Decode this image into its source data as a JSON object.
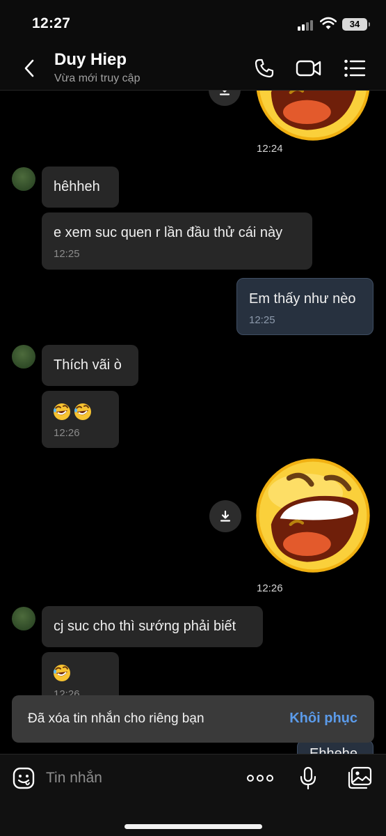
{
  "status_bar": {
    "time": "12:27",
    "battery": "34"
  },
  "header": {
    "contact_name": "Duy Hiep",
    "contact_status": "Vừa mới truy cập",
    "icons": [
      "back-arrow-icon",
      "phone-icon",
      "video-camera-icon",
      "list-menu-icon"
    ]
  },
  "messages": [
    {
      "id": "m0",
      "type": "sticker",
      "direction": "outgoing",
      "sticker": "laughing-face",
      "time": "12:24"
    },
    {
      "id": "m1",
      "type": "text",
      "direction": "incoming",
      "text": "hêhheh"
    },
    {
      "id": "m2",
      "type": "text",
      "direction": "incoming",
      "text": "e xem suc quen r lần đầu thử cái này",
      "time": "12:25"
    },
    {
      "id": "m3",
      "type": "text",
      "direction": "outgoing",
      "text": "Em thấy như nèo",
      "time": "12:25"
    },
    {
      "id": "m4",
      "type": "text",
      "direction": "incoming",
      "text": "Thích vãi ò"
    },
    {
      "id": "m5",
      "type": "emoji",
      "direction": "incoming",
      "emoji": [
        "rolling-on-floor-laughing",
        "rolling-on-floor-laughing"
      ],
      "time": "12:26"
    },
    {
      "id": "m6",
      "type": "sticker",
      "direction": "outgoing",
      "sticker": "laughing-face",
      "time": "12:26"
    },
    {
      "id": "m7",
      "type": "text",
      "direction": "incoming",
      "text": "cj suc cho thì sướng phải biết"
    },
    {
      "id": "m8",
      "type": "emoji",
      "direction": "incoming",
      "emoji": [
        "rolling-on-floor-laughing"
      ],
      "time": "12:26"
    },
    {
      "id": "m9",
      "type": "text",
      "direction": "outgoing",
      "text": "Ehhehe"
    }
  ],
  "toast": {
    "text": "Đã xóa tin nhắn cho riêng bạn",
    "action": "Khôi phục"
  },
  "input_bar": {
    "placeholder": "Tin nhắn",
    "icons": [
      "emoji-sticker-icon",
      "more-dots-icon",
      "microphone-icon",
      "image-icon"
    ]
  },
  "colors": {
    "background": "#000000",
    "incoming_bubble": "#272727",
    "outgoing_bubble": "#27313f",
    "outgoing_border": "#3f4e63",
    "accent": "#5b9bea",
    "toast_bg": "#3a3a3a"
  }
}
